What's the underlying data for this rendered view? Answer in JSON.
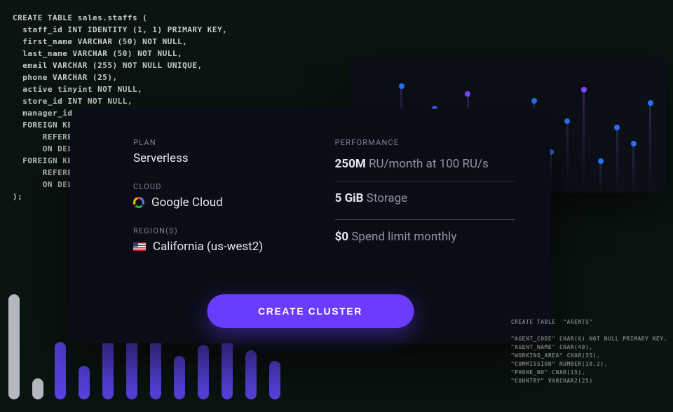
{
  "code_bg": {
    "lines": [
      "CREATE TABLE sales.staffs (",
      "  staff_id INT IDENTITY (1, 1) PRIMARY KEY,",
      "  first_name VARCHAR (50) NOT NULL,",
      "  last_name VARCHAR (50) NOT NULL,",
      "  email VARCHAR (255) NOT NULL UNIQUE,",
      "  phone VARCHAR (25),",
      "  active tinyint NOT NULL,",
      "  store_id INT NOT NULL,",
      "  manager_id INT,",
      "  FOREIGN KEY (store_id)",
      "      REFERENCES sales.stores (store_id)",
      "      ON DELETE CASCADE ON UPDATE CASCADE,",
      "  FOREIGN KEY (manager_id)",
      "      REFERENCES sales.staffs (staff_id)",
      "      ON DELETE NO ACTION ON UPDATE NO ACTION",
      ");"
    ]
  },
  "code_small": {
    "lines": [
      "CREATE TABLE  \"AGENTS\"",
      "",
      "\"AGENT_CODE\" CHAR(6) NOT NULL PRIMARY KEY,",
      "\"AGENT_NAME\" CHAR(40),",
      "\"WORKING_AREA\" CHAR(35),",
      "\"COMMISSION\" NUMBER(10,2),",
      "\"PHONE_NO\" CHAR(15),",
      "\"COUNTRY\" VARCHAR2(25)"
    ]
  },
  "config": {
    "plan_label": "PLAN",
    "plan_value": "Serverless",
    "cloud_label": "CLOUD",
    "cloud_value": "Google Cloud",
    "region_label": "REGION(S)",
    "region_value": "California (us-west2)"
  },
  "performance": {
    "label": "PERFORMANCE",
    "ru_bold": "250M",
    "ru_rest": "RU/month at 100 RU/s",
    "storage_bold": "5 GiB",
    "storage_rest": "Storage",
    "spend_bold": "$0",
    "spend_rest": "Spend limit monthly"
  },
  "cta": {
    "create_label": "CREATE CLUSTER"
  },
  "chart_data": {
    "type": "bar",
    "title": "",
    "note": "Decorative sparkline-style columns; values are approximate pixel heights relative to panel, not literal data.",
    "series": [
      {
        "name": "c01",
        "color": "#1f2a44",
        "dot": "#2b71ff",
        "value": 60
      },
      {
        "name": "c02",
        "color": "#1f2a44",
        "dot": "#2b71ff",
        "value": 40
      },
      {
        "name": "c03",
        "color": "#1f2a44",
        "dot": "#2b71ff",
        "value": 95
      },
      {
        "name": "c04",
        "color": "#1f2a44",
        "dot": "#2b71ff",
        "value": 30
      },
      {
        "name": "c05",
        "color": "#1f2a44",
        "dot": "#2b71ff",
        "value": 75
      },
      {
        "name": "c06",
        "color": "#1f2a44",
        "dot": "#2b71ff",
        "value": 55
      },
      {
        "name": "c07",
        "color": "#332356",
        "dot": "#7a4bff",
        "value": 88
      },
      {
        "name": "c08",
        "color": "#1f2a44",
        "dot": "#2b71ff",
        "value": 20
      },
      {
        "name": "c09",
        "color": "#1f2a44",
        "dot": "#2b71ff",
        "value": 70
      },
      {
        "name": "c10",
        "color": "#1f2a44",
        "dot": "#2b71ff",
        "value": 48
      },
      {
        "name": "c11",
        "color": "#1f2a44",
        "dot": "#2b71ff",
        "value": 82
      },
      {
        "name": "c12",
        "color": "#1f2a44",
        "dot": "#2b71ff",
        "value": 36
      },
      {
        "name": "c13",
        "color": "#1f2a44",
        "dot": "#2b71ff",
        "value": 64
      },
      {
        "name": "c14",
        "color": "#332356",
        "dot": "#7a4bff",
        "value": 92
      },
      {
        "name": "c15",
        "color": "#1f2a44",
        "dot": "#2b71ff",
        "value": 28
      },
      {
        "name": "c16",
        "color": "#1f2a44",
        "dot": "#2b71ff",
        "value": 58
      },
      {
        "name": "c17",
        "color": "#1f2a44",
        "dot": "#2b71ff",
        "value": 44
      },
      {
        "name": "c18",
        "color": "#1f2a44",
        "dot": "#2b71ff",
        "value": 80
      }
    ]
  },
  "bars_gray": {
    "heights": [
      150,
      30
    ]
  },
  "bars_purple": {
    "heights": [
      82,
      48,
      120,
      88,
      115,
      62,
      78,
      100,
      70,
      55
    ]
  }
}
